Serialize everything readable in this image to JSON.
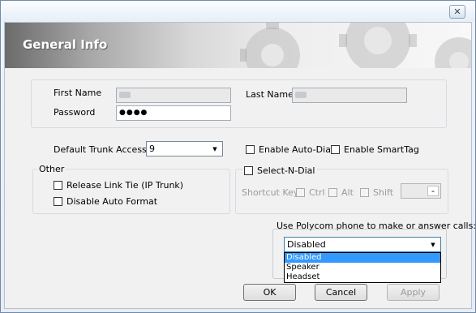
{
  "window": {
    "close_glyph": "✕"
  },
  "banner": {
    "title": "General Info"
  },
  "user": {
    "first_name_label": "First Name",
    "last_name_label": "Last Name",
    "password_label": "Password",
    "password_value": "●●●●"
  },
  "trunk": {
    "label": "Default Trunk Access",
    "value": "9"
  },
  "options": {
    "auto_dial": "Enable Auto-Dial",
    "smarttag": "Enable SmartTag"
  },
  "other": {
    "title": "Other",
    "release_link": "Release Link Tie (IP Trunk)",
    "disable_auto_format": "Disable Auto Format"
  },
  "snd": {
    "title": "Select-N-Dial",
    "shortcut_label": "Shortcut Key:",
    "ctrl": "Ctrl",
    "alt": "Alt",
    "shift": "Shift",
    "key_value": "-"
  },
  "polycom": {
    "label": "Use Polycom phone to make or answer calls:",
    "selected": "Disabled",
    "options": [
      "Disabled",
      "Speaker",
      "Headset"
    ]
  },
  "buttons": {
    "ok": "OK",
    "cancel": "Cancel",
    "apply": "Apply"
  },
  "colors": {
    "selection": "#3399ff",
    "disabled_text": "#9a9a9a"
  }
}
